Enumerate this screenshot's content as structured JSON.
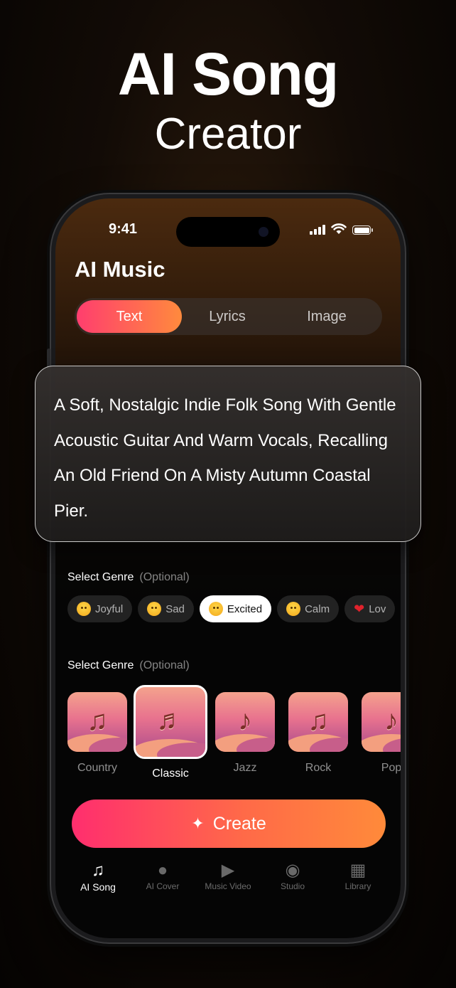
{
  "hero": {
    "title": "AI Song",
    "subtitle": "Creator"
  },
  "status": {
    "time": "9:41"
  },
  "app": {
    "title": "AI Music"
  },
  "tabs": [
    {
      "label": "Text",
      "active": true
    },
    {
      "label": "Lyrics",
      "active": false
    },
    {
      "label": "Image",
      "active": false
    }
  ],
  "prompt": {
    "text": "A Soft, Nostalgic Indie Folk Song With Gentle Acoustic Guitar And Warm Vocals, Recalling An Old Friend On A Misty Autumn Coastal Pier."
  },
  "mood_section": {
    "label": "Select Genre",
    "optional": "(Optional)"
  },
  "moods": [
    {
      "label": "Joyful",
      "icon": "grin-emoji-icon"
    },
    {
      "label": "Sad",
      "icon": "cry-emoji-icon"
    },
    {
      "label": "Excited",
      "icon": "excited-emoji-icon",
      "selected": true
    },
    {
      "label": "Calm",
      "icon": "calm-emoji-icon"
    },
    {
      "label": "Lov",
      "icon": "heart-icon"
    }
  ],
  "genre_section": {
    "label": "Select Genre",
    "optional": "(Optional)"
  },
  "genres": [
    {
      "label": "Country",
      "icon": "guitar-icon"
    },
    {
      "label": "Classic",
      "icon": "piano-icon",
      "selected": true
    },
    {
      "label": "Jazz",
      "icon": "saxophone-icon"
    },
    {
      "label": "Rock",
      "icon": "electric-guitar-icon"
    },
    {
      "label": "Pop",
      "icon": "microphone-icon"
    }
  ],
  "create_button": {
    "label": "Create",
    "icon": "sparkle-icon"
  },
  "bottom_nav": [
    {
      "label": "AI Song",
      "icon": "music-note-icon",
      "active": true
    },
    {
      "label": "AI Cover",
      "icon": "microphone-icon"
    },
    {
      "label": "Music Video",
      "icon": "video-icon"
    },
    {
      "label": "Studio",
      "icon": "studio-icon"
    },
    {
      "label": "Library",
      "icon": "library-icon"
    }
  ],
  "colors": {
    "accent_start": "#ff3e6e",
    "accent_end": "#ff8a3d",
    "background": "#050505"
  }
}
